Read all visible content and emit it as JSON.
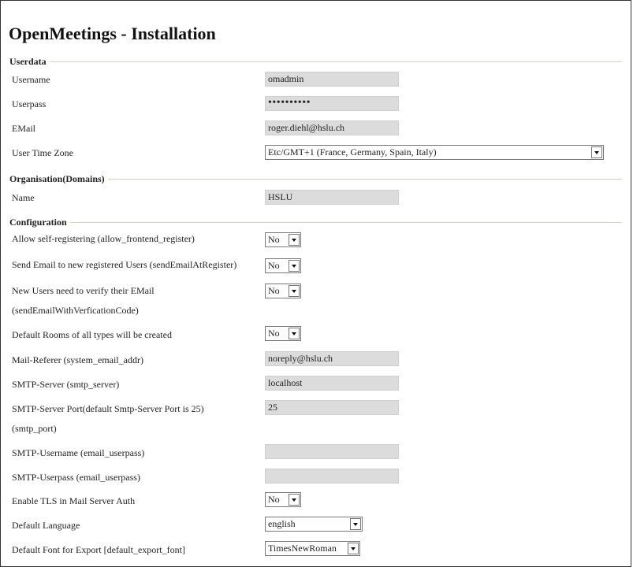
{
  "title": "OpenMeetings - Installation",
  "sections": {
    "userdata": "Userdata",
    "organisation": "Organisation(Domains)",
    "configuration": "Configuration"
  },
  "userdata": {
    "username_label": "Username",
    "username_value": "omadmin",
    "userpass_label": "Userpass",
    "userpass_value": "••••••••••",
    "email_label": "EMail",
    "email_value": "roger.diehl@hslu.ch",
    "timezone_label": "User Time Zone",
    "timezone_value": "Etc/GMT+1 (France, Germany, Spain, Italy)"
  },
  "organisation": {
    "name_label": "Name",
    "name_value": "HSLU"
  },
  "configuration": {
    "allow_register_label": "Allow self-registering (allow_frontend_register)",
    "allow_register_value": "No",
    "send_email_label": "Send Email to new registered Users (sendEmailAtRegister)",
    "send_email_value": "No",
    "verify_email_label_1": "New Users need to verify their EMail",
    "verify_email_label_2": "(sendEmailWithVerficationCode)",
    "verify_email_value": "No",
    "default_rooms_label": "Default Rooms of all types will be created",
    "default_rooms_value": "No",
    "mail_referer_label": "Mail-Referer (system_email_addr)",
    "mail_referer_value": "noreply@hslu.ch",
    "smtp_server_label": "SMTP-Server (smtp_server)",
    "smtp_server_value": "localhost",
    "smtp_port_label_1": "SMTP-Server Port(default Smtp-Server Port is 25)",
    "smtp_port_label_2": "(smtp_port)",
    "smtp_port_value": "25",
    "smtp_user_label": "SMTP-Username (email_userpass)",
    "smtp_user_value": "",
    "smtp_pass_label": "SMTP-Userpass (email_userpass)",
    "smtp_pass_value": "",
    "tls_label": "Enable TLS in Mail Server Auth",
    "tls_value": "No",
    "language_label": "Default Language",
    "language_value": "english",
    "font_label": "Default Font for Export [default_export_font]",
    "font_value": "TimesNewRoman"
  }
}
